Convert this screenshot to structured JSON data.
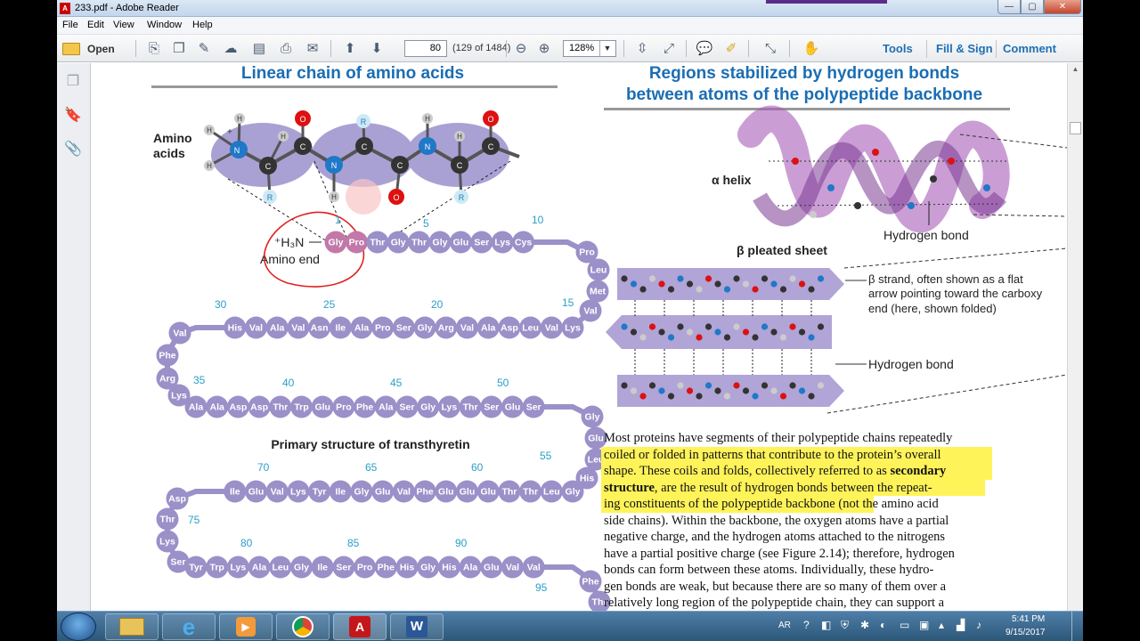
{
  "window": {
    "title": "233.pdf - Adobe Reader",
    "min": "—",
    "max": "▢",
    "close": "✕"
  },
  "menu": [
    "File",
    "Edit",
    "View",
    "Window",
    "Help"
  ],
  "toolbar": {
    "open": "Open",
    "page": "80",
    "page_count": "(129 of 1484)",
    "zoom": "128%",
    "tools": "Tools",
    "fill_sign": "Fill & Sign",
    "comment": "Comment"
  },
  "doc": {
    "left_title": "Linear chain of amino acids",
    "right_title_1": "Regions stabilized by hydrogen bonds",
    "right_title_2": "between atoms of the polypeptide backbone",
    "amino_acids": [
      "Amino",
      "acids"
    ],
    "amino_end_1": "⁺H₃N",
    "amino_end_2": "Amino end",
    "primary_label": "Primary structure of transthyretin",
    "alpha_helix": "α helix",
    "hydrogen_bond": "Hydrogen bond",
    "beta_sheet": "β pleated sheet",
    "beta_strand": [
      "β strand, often shown as a flat",
      "arrow pointing toward the carboxy",
      "end (here, shown folded)"
    ],
    "hydrogen_bond_2": "Hydrogen bond",
    "paragraph": [
      "Most proteins have segments of their polypeptide chains repeatedly",
      "coiled or folded in patterns that contribute to the protein’s overall",
      "shape. These coils and folds, collectively referred to as ",
      "secondary",
      "structure",
      ", are the result of hydrogen bonds between the repeat-",
      "ing constituents of the polypeptide backbone",
      " (not the amino acid",
      "side chains). Within the backbone, the oxygen atoms have a partial",
      "negative charge, and the hydrogen atoms attached to the nitrogens",
      "have a partial positive charge (see Figure 2.14); therefore, hydrogen",
      "bonds can form between these atoms. Individually, these hydro-",
      "gen bonds are weak, but because there are so many of them over a",
      "relatively long region of the polypeptide chain, they can support a"
    ],
    "chain": {
      "row1": [
        "Gly",
        "Pro",
        "Thr",
        "Gly",
        "Thr",
        "Gly",
        "Glu",
        "Ser",
        "Lys",
        "Cys"
      ],
      "right1": [
        "Pro",
        "Leu",
        "Met",
        "Val"
      ],
      "row2": [
        "Lys",
        "Val",
        "Leu",
        "Asp",
        "Ala",
        "Val",
        "Arg",
        "Gly",
        "Ser",
        "Pro",
        "Ala",
        "Ile",
        "Asn",
        "Val",
        "Ala",
        "Val",
        "His"
      ],
      "left2": [
        "Val",
        "Phe",
        "Arg",
        "Lys"
      ],
      "row3": [
        "Ala",
        "Ala",
        "Asp",
        "Asp",
        "Thr",
        "Trp",
        "Glu",
        "Pro",
        "Phe",
        "Ala",
        "Ser",
        "Gly",
        "Lys",
        "Thr",
        "Ser",
        "Glu",
        "Ser"
      ],
      "right3": [
        "Gly",
        "Glu",
        "Leu",
        "His"
      ],
      "row4": [
        "Gly",
        "Leu",
        "Thr",
        "Thr",
        "Glu",
        "Glu",
        "Glu",
        "Phe",
        "Val",
        "Glu",
        "Gly",
        "Ile",
        "Tyr",
        "Lys",
        "Val",
        "Glu",
        "Ile"
      ],
      "left4": [
        "Asp",
        "Thr",
        "Lys",
        "Ser"
      ],
      "row5": [
        "Tyr",
        "Trp",
        "Lys",
        "Ala",
        "Leu",
        "Gly",
        "Ile",
        "Ser",
        "Pro",
        "Phe",
        "His",
        "Gly",
        "His",
        "Ala",
        "Glu",
        "Val",
        "Val"
      ],
      "right5": [
        "Phe",
        "Thr"
      ],
      "numbers": [
        "1",
        "5",
        "10",
        "15",
        "20",
        "25",
        "30",
        "35",
        "40",
        "45",
        "50",
        "55",
        "60",
        "65",
        "70",
        "75",
        "80",
        "85",
        "90",
        "95"
      ]
    }
  },
  "tray": {
    "lang": "AR",
    "time": "5:41 PM",
    "date": "9/15/2017"
  },
  "colors": {
    "bead": "#9b90c8",
    "accent_blue": "#1b6db3",
    "number_blue": "#2a9fc9",
    "highlight": "#fff35a",
    "red_circle": "#e02020"
  }
}
